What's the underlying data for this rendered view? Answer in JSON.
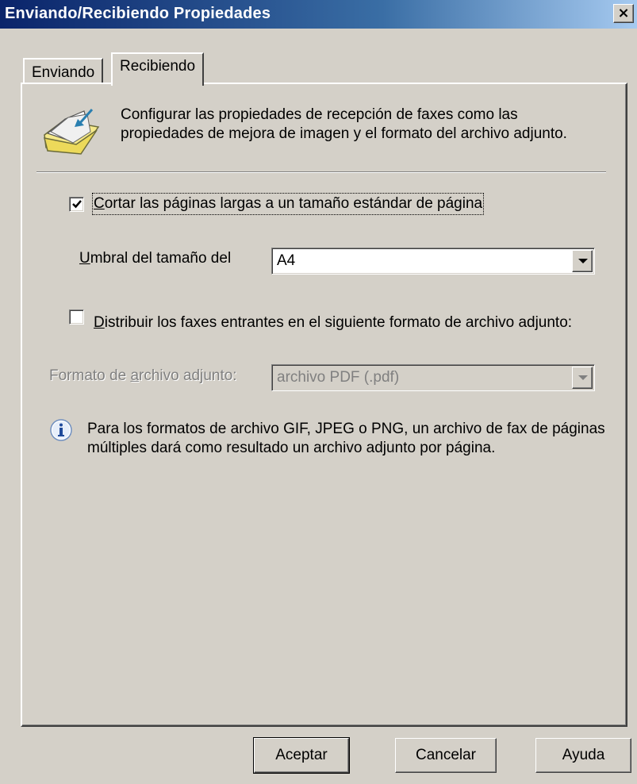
{
  "window": {
    "title": "Enviando/Recibiendo Propiedades",
    "close_label": "×"
  },
  "tabs": [
    {
      "label": "Enviando",
      "active": false
    },
    {
      "label": "Recibiendo",
      "active": true
    }
  ],
  "description": "Configurar las propiedades de recepción de faxes como las propiedades de mejora de imagen y el formato del archivo adjunto.",
  "crop_pages": {
    "checked": true,
    "label_accel": "C",
    "label_rest": "ortar las páginas largas a un tamaño estándar de página"
  },
  "threshold": {
    "label_accel": "U",
    "label_rest": "mbral del tamaño del",
    "value": "A4"
  },
  "distribute": {
    "checked": false,
    "label_accel": "D",
    "label_rest": "istribuir los faxes entrantes en el siguiente formato de archivo adjunto:"
  },
  "attachment_format": {
    "label_pre": "Formato de ",
    "label_accel": "a",
    "label_post": "rchivo adjunto:",
    "value": "archivo PDF (.pdf)",
    "disabled": true
  },
  "info": "Para los formatos de archivo GIF, JPEG o PNG, un archivo de fax de páginas múltiples dará como resultado un archivo adjunto por página.",
  "buttons": {
    "ok": "Aceptar",
    "cancel": "Cancelar",
    "help": "Ayuda"
  }
}
